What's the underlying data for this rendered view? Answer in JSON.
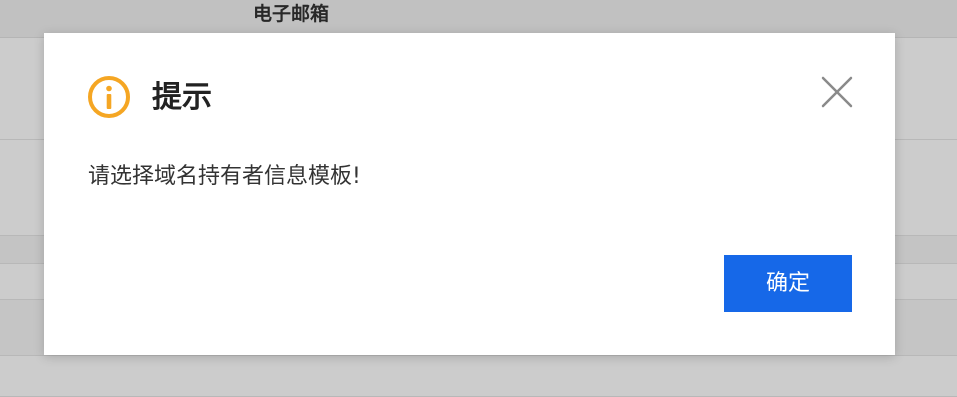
{
  "background": {
    "header_label": "电子邮箱"
  },
  "dialog": {
    "title": "提示",
    "message": "请选择域名持有者信息模板!",
    "confirm_label": "确定",
    "icons": {
      "status": "info-icon",
      "close": "close-icon"
    },
    "colors": {
      "info": "#f5a623",
      "primary_button": "#1668e8"
    }
  }
}
